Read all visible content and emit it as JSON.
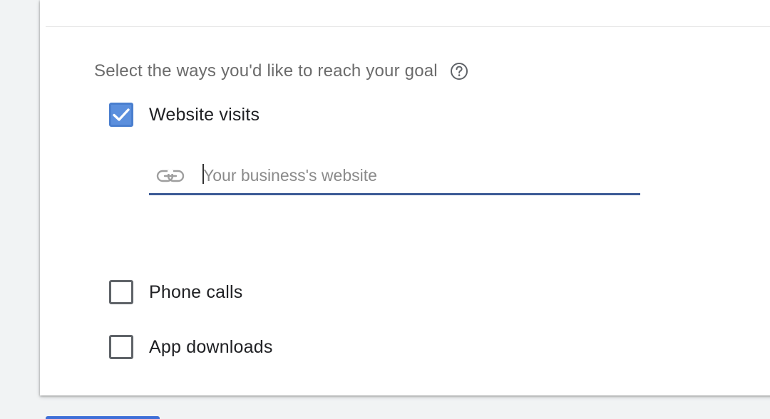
{
  "section": {
    "heading": "Select the ways you'd like to reach your goal",
    "help_icon": "help-circle-icon"
  },
  "options": [
    {
      "label": "Website visits",
      "checked": true
    },
    {
      "label": "Phone calls",
      "checked": false
    },
    {
      "label": "App downloads",
      "checked": false
    }
  ],
  "website_field": {
    "placeholder": "Your business's website",
    "value": "",
    "icon": "link-icon"
  },
  "colors": {
    "checkbox_checked": "#5b8fdd",
    "field_underline": "#3c5a96",
    "next_button": "#3f6fd8"
  }
}
